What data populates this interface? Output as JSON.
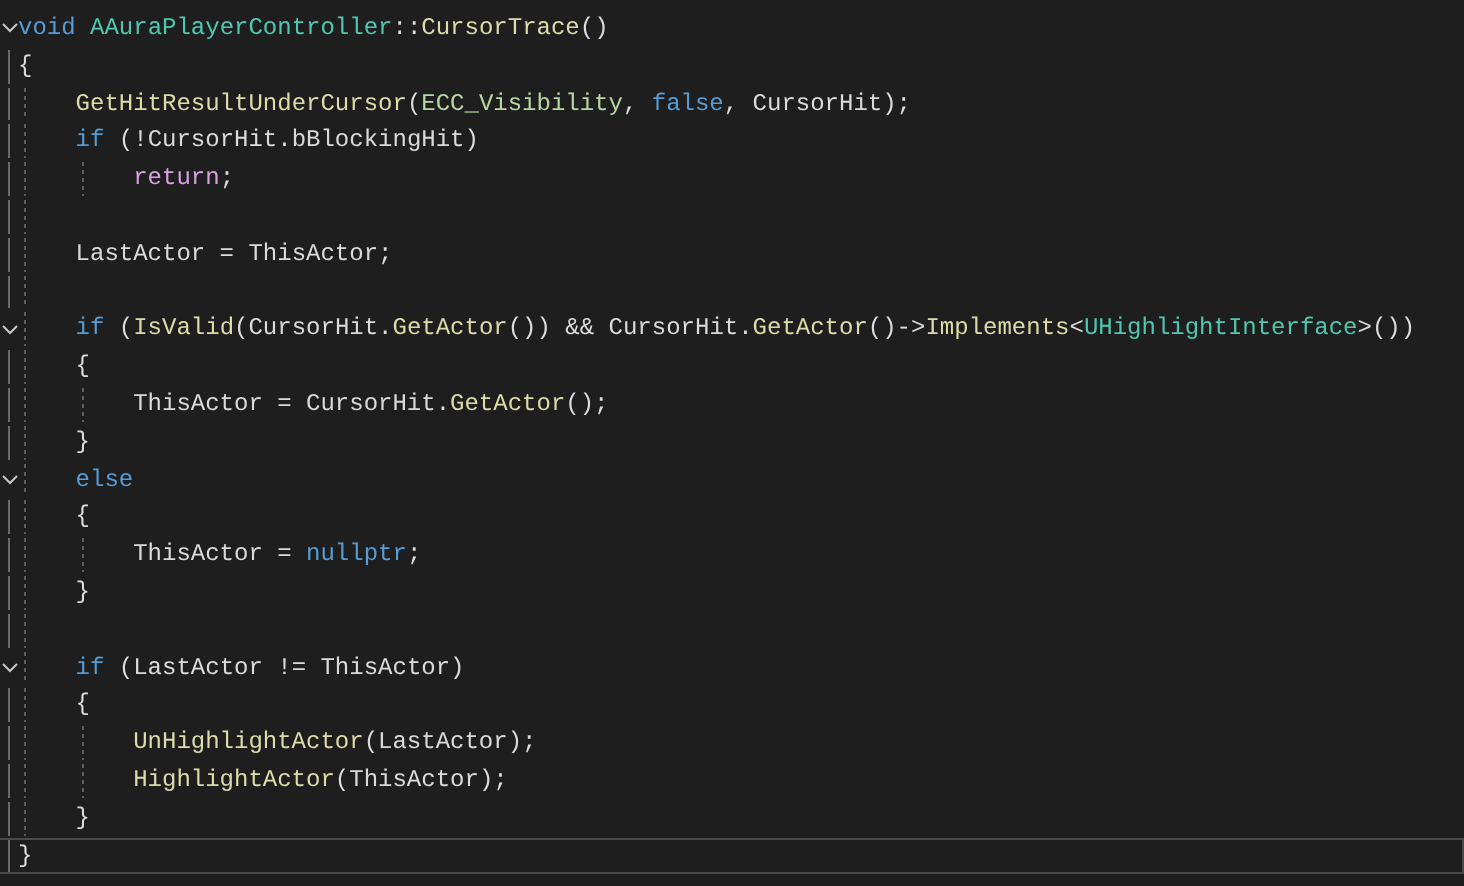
{
  "editor": {
    "lines": [
      {
        "foldable": true,
        "current": false,
        "tokens": [
          {
            "kind": "keyword",
            "text": "void "
          },
          {
            "kind": "type",
            "text": "AAuraPlayerController"
          },
          {
            "kind": "plain",
            "text": "::"
          },
          {
            "kind": "function",
            "text": "CursorTrace"
          },
          {
            "kind": "plain",
            "text": "()"
          }
        ]
      },
      {
        "foldable": false,
        "current": false,
        "tokens": [
          {
            "kind": "plain",
            "text": "{"
          }
        ],
        "children": [
          {
            "foldable": false,
            "current": false,
            "tokens": [
              {
                "kind": "function",
                "text": "GetHitResultUnderCursor"
              },
              {
                "kind": "plain",
                "text": "("
              },
              {
                "kind": "enum",
                "text": "ECC_Visibility"
              },
              {
                "kind": "plain",
                "text": ", "
              },
              {
                "kind": "keyword",
                "text": "false"
              },
              {
                "kind": "plain",
                "text": ", "
              },
              {
                "kind": "variable",
                "text": "CursorHit"
              },
              {
                "kind": "plain",
                "text": ");"
              }
            ]
          },
          {
            "foldable": false,
            "current": false,
            "tokens": [
              {
                "kind": "keyword",
                "text": "if"
              },
              {
                "kind": "plain",
                "text": " (!"
              },
              {
                "kind": "variable",
                "text": "CursorHit"
              },
              {
                "kind": "plain",
                "text": "."
              },
              {
                "kind": "variable",
                "text": "bBlockingHit"
              },
              {
                "kind": "plain",
                "text": ")"
              }
            ],
            "children": [
              {
                "foldable": false,
                "current": false,
                "tokens": [
                  {
                    "kind": "control",
                    "text": "return"
                  },
                  {
                    "kind": "plain",
                    "text": ";"
                  }
                ]
              }
            ]
          },
          {
            "foldable": false,
            "current": false
          },
          {
            "foldable": false,
            "current": false,
            "tokens": [
              {
                "kind": "variable",
                "text": "LastActor"
              },
              {
                "kind": "plain",
                "text": " = "
              },
              {
                "kind": "variable",
                "text": "ThisActor"
              },
              {
                "kind": "plain",
                "text": ";"
              }
            ]
          },
          {
            "foldable": false,
            "current": false
          },
          {
            "foldable": true,
            "current": false,
            "tokens": [
              {
                "kind": "keyword",
                "text": "if"
              },
              {
                "kind": "plain",
                "text": " ("
              },
              {
                "kind": "function",
                "text": "IsValid"
              },
              {
                "kind": "plain",
                "text": "("
              },
              {
                "kind": "variable",
                "text": "CursorHit"
              },
              {
                "kind": "plain",
                "text": "."
              },
              {
                "kind": "function",
                "text": "GetActor"
              },
              {
                "kind": "plain",
                "text": "()) && "
              },
              {
                "kind": "variable",
                "text": "CursorHit"
              },
              {
                "kind": "plain",
                "text": "."
              },
              {
                "kind": "function",
                "text": "GetActor"
              },
              {
                "kind": "plain",
                "text": "()->"
              },
              {
                "kind": "function",
                "text": "Implements"
              },
              {
                "kind": "plain",
                "text": "<"
              },
              {
                "kind": "type",
                "text": "UHighlightInterface"
              },
              {
                "kind": "plain",
                "text": ">())"
              }
            ]
          },
          {
            "foldable": false,
            "current": false,
            "tokens": [
              {
                "kind": "plain",
                "text": "{"
              }
            ],
            "children": [
              {
                "foldable": false,
                "current": false,
                "tokens": [
                  {
                    "kind": "variable",
                    "text": "ThisActor"
                  },
                  {
                    "kind": "plain",
                    "text": " = "
                  },
                  {
                    "kind": "variable",
                    "text": "CursorHit"
                  },
                  {
                    "kind": "plain",
                    "text": "."
                  },
                  {
                    "kind": "function",
                    "text": "GetActor"
                  },
                  {
                    "kind": "plain",
                    "text": "();"
                  }
                ]
              }
            ]
          },
          {
            "foldable": false,
            "current": false,
            "tokens": [
              {
                "kind": "plain",
                "text": "}"
              }
            ]
          },
          {
            "foldable": true,
            "current": false,
            "tokens": [
              {
                "kind": "keyword",
                "text": "else"
              }
            ]
          },
          {
            "foldable": false,
            "current": false,
            "tokens": [
              {
                "kind": "plain",
                "text": "{"
              }
            ],
            "children": [
              {
                "foldable": false,
                "current": false,
                "tokens": [
                  {
                    "kind": "variable",
                    "text": "ThisActor"
                  },
                  {
                    "kind": "plain",
                    "text": " = "
                  },
                  {
                    "kind": "keyword",
                    "text": "nullptr"
                  },
                  {
                    "kind": "plain",
                    "text": ";"
                  }
                ]
              }
            ]
          },
          {
            "foldable": false,
            "current": false,
            "tokens": [
              {
                "kind": "plain",
                "text": "}"
              }
            ]
          },
          {
            "foldable": false,
            "current": false
          },
          {
            "foldable": true,
            "current": false,
            "tokens": [
              {
                "kind": "keyword",
                "text": "if"
              },
              {
                "kind": "plain",
                "text": " ("
              },
              {
                "kind": "variable",
                "text": "LastActor"
              },
              {
                "kind": "plain",
                "text": " != "
              },
              {
                "kind": "variable",
                "text": "ThisActor"
              },
              {
                "kind": "plain",
                "text": ")"
              }
            ]
          },
          {
            "foldable": false,
            "current": false,
            "tokens": [
              {
                "kind": "plain",
                "text": "{"
              }
            ],
            "children": [
              {
                "foldable": false,
                "current": false,
                "tokens": [
                  {
                    "kind": "function",
                    "text": "UnHighlightActor"
                  },
                  {
                    "kind": "plain",
                    "text": "("
                  },
                  {
                    "kind": "variable",
                    "text": "LastActor"
                  },
                  {
                    "kind": "plain",
                    "text": ");"
                  }
                ]
              },
              {
                "foldable": false,
                "current": false,
                "tokens": [
                  {
                    "kind": "function",
                    "text": "HighlightActor"
                  },
                  {
                    "kind": "plain",
                    "text": "("
                  },
                  {
                    "kind": "variable",
                    "text": "ThisActor"
                  },
                  {
                    "kind": "plain",
                    "text": ");"
                  }
                ]
              }
            ]
          },
          {
            "foldable": false,
            "current": false,
            "tokens": [
              {
                "kind": "plain",
                "text": "}"
              }
            ]
          }
        ]
      },
      {
        "foldable": false,
        "current": true,
        "tokens": [
          {
            "kind": "plain",
            "text": "}"
          }
        ]
      }
    ]
  }
}
